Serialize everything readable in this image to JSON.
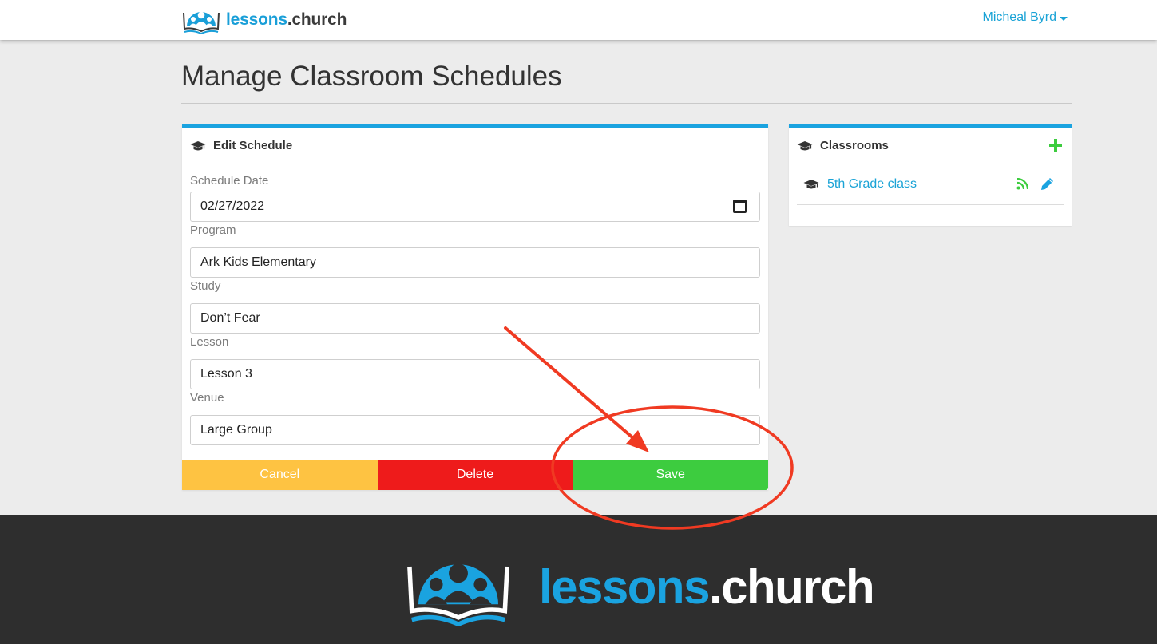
{
  "header": {
    "brand": {
      "name": "lessons",
      "suffix": ".church"
    },
    "user_name": "Micheal Byrd"
  },
  "page": {
    "title": "Manage Classroom Schedules"
  },
  "edit_schedule": {
    "title": "Edit Schedule",
    "fields": [
      {
        "label": "Schedule Date",
        "value": "02/27/2022"
      },
      {
        "label": "Program",
        "value": "Ark Kids Elementary"
      },
      {
        "label": "Study",
        "value": "Don’t Fear"
      },
      {
        "label": "Lesson",
        "value": "Lesson 3"
      },
      {
        "label": "Venue",
        "value": "Large Group"
      }
    ],
    "buttons": {
      "cancel": "Cancel",
      "delete": "Delete",
      "save": "Save"
    }
  },
  "classrooms": {
    "title": "Classrooms",
    "items": [
      {
        "name": "5th Grade class"
      }
    ]
  },
  "footer": {
    "brand": {
      "name": "lessons",
      "suffix": ".church"
    }
  },
  "colors": {
    "accent": "#1aa3e0",
    "cancel": "#fec342",
    "delete": "#ee1b1b",
    "save": "#3dcc3f",
    "annotation": "#f03a22",
    "footer_bg": "#2e2e2e"
  },
  "icons": [
    "brand-logo-icon",
    "graduation-cap-icon",
    "calendar-icon",
    "plus-icon",
    "rss-icon",
    "pencil-icon",
    "caret-down-icon"
  ]
}
